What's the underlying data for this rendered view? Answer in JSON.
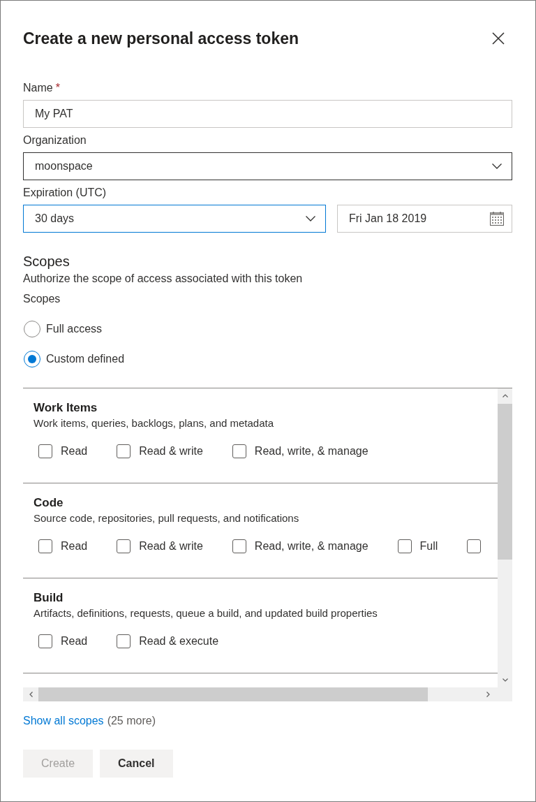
{
  "dialog": {
    "title": "Create a new personal access token"
  },
  "fields": [
    {
      "kind": "text",
      "label": "Name",
      "required_mark": "*",
      "value": "My PAT",
      "focused": false,
      "hovered": false
    },
    {
      "kind": "select",
      "label": "Organization",
      "value": "moonspace",
      "focused": false,
      "hovered": true
    }
  ],
  "expiration": {
    "label": "Expiration (UTC)",
    "duration": {
      "value": "30 days",
      "focused": true
    },
    "date": {
      "value": "Fri Jan 18 2019",
      "focused": false,
      "hovered": false
    }
  },
  "scopes": {
    "heading": "Scopes",
    "description": "Authorize the scope of access associated with this token",
    "label": "Scopes",
    "options": [
      {
        "label": "Full access",
        "selected": false
      },
      {
        "label": "Custom defined",
        "selected": true
      }
    ],
    "groups": [
      {
        "title": "Work Items",
        "description": "Work items, queries, backlogs, plans, and metadata",
        "permissions": [
          {
            "label": "Read",
            "checked": false
          },
          {
            "label": "Read & write",
            "checked": false
          },
          {
            "label": "Read, write, & manage",
            "checked": false
          }
        ]
      },
      {
        "title": "Code",
        "description": "Source code, repositories, pull requests, and notifications",
        "permissions": [
          {
            "label": "Read",
            "checked": false
          },
          {
            "label": "Read & write",
            "checked": false
          },
          {
            "label": "Read, write, & manage",
            "checked": false
          },
          {
            "label": "Full",
            "checked": false
          },
          {
            "checked": false
          }
        ]
      },
      {
        "title": "Build",
        "description": "Artifacts, definitions, requests, queue a build, and updated build properties",
        "permissions": [
          {
            "label": "Read",
            "checked": false
          },
          {
            "label": "Read & execute",
            "checked": false
          }
        ]
      }
    ],
    "show_all_link": "Show all scopes",
    "more_count": "(25 more)"
  },
  "buttons": [
    {
      "label": "Create",
      "kind": "primary",
      "disabled": true
    },
    {
      "label": "Cancel",
      "kind": "default",
      "disabled": false
    }
  ]
}
